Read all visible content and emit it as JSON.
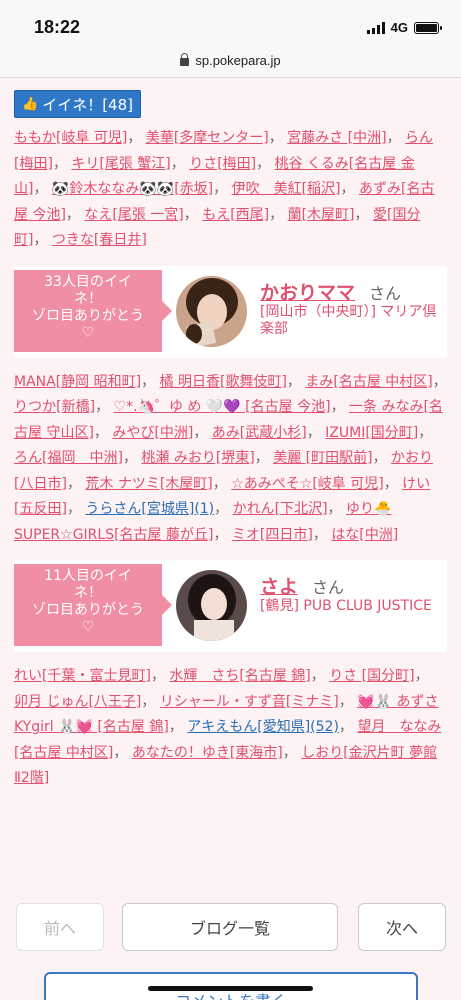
{
  "status": {
    "time": "18:22",
    "network": "4G"
  },
  "browser": {
    "url": "sp.pokepara.jp"
  },
  "like_button": {
    "label": "イイネ！[48]"
  },
  "names_block1": [
    {
      "t": "ももか[岐阜 可児]"
    },
    {
      "t": "美華[多摩センター]"
    },
    {
      "t": "宮藤みさ [中洲]"
    },
    {
      "t": "らん[梅田]"
    },
    {
      "t": "キリ[尾張 蟹江]"
    },
    {
      "t": "りさ[梅田]"
    },
    {
      "t": "桃谷 くるみ[名古屋 金山]"
    },
    {
      "t": "🐼鈴木ななみ🐼🐼[赤坂]"
    },
    {
      "t": "伊吹　美紅[稲沢]"
    },
    {
      "t": "あずみ[名古屋 今池]"
    },
    {
      "t": "なえ[尾張 一宮]"
    },
    {
      "t": "もえ[西尾]"
    },
    {
      "t": "蘭[木屋町]"
    },
    {
      "t": "愛[国分町]"
    },
    {
      "t": "つきな[春日井]"
    }
  ],
  "card1": {
    "badge_line1": "33人目のイイ",
    "badge_line2": "ネ！",
    "badge_line3": "ゾロ目ありがとう",
    "badge_heart": "♡",
    "name": "かおりママ",
    "san": "さん",
    "shop": "[岡山市（中央町）] マリア倶楽部"
  },
  "names_block2": [
    {
      "t": "MANA[静岡 昭和町]"
    },
    {
      "t": "橘 明日香[歌舞伎町]"
    },
    {
      "t": "まみ[名古屋 中村区]"
    },
    {
      "t": "りつか[新橋]"
    },
    {
      "t": "♡*.🦄゜ゆ め 🤍💜 [名古屋 今池]"
    },
    {
      "t": "一条 みなみ[名古屋 守山区]"
    },
    {
      "t": "みやび[中洲]"
    },
    {
      "t": "あみ[武蔵小杉]"
    },
    {
      "t": "IZUMI[国分町]"
    },
    {
      "t": "ろん[福岡　中洲]"
    },
    {
      "t": "桃瀬 みおり[堺東]"
    },
    {
      "t": "美麗 [町田駅前]"
    },
    {
      "t": "かおり[八日市]"
    },
    {
      "t": "荒木 ナツミ[木屋町]"
    },
    {
      "t": "☆あみぺそ☆[岐阜 可児]"
    },
    {
      "t": "けい[五反田]"
    },
    {
      "t": "うらさん[宮城県](1)",
      "blue": true
    },
    {
      "t": "かれん[下北沢]"
    },
    {
      "t": "ゆり🐣SUPER☆GIRLS[名古屋 藤が丘]"
    },
    {
      "t": "ミオ[四日市]"
    },
    {
      "t": "はな[中洲]"
    }
  ],
  "card2": {
    "badge_line1": "11人目のイイ",
    "badge_line2": "ネ！",
    "badge_line3": "ゾロ目ありがとう",
    "badge_heart": "♡",
    "name": "さよ",
    "san": "さん",
    "shop": "[鶴見] PUB CLUB JUSTICE"
  },
  "names_block3": [
    {
      "t": "れい[千葉・富士見町]"
    },
    {
      "t": "水輝　さち[名古屋 錦]"
    },
    {
      "t": "りさ [国分町]"
    },
    {
      "t": "卯月 じゅん[八王子]"
    },
    {
      "t": "リシャール・すず音[ミナミ]"
    },
    {
      "t": "💓🐰 あずさ KYgirl 🐰💓 [名古屋 錦]"
    },
    {
      "t": "アキえもん[愛知県](52)",
      "blue": true
    },
    {
      "t": "望月　ななみ[名古屋 中村区]"
    },
    {
      "t": "あなたの！ゆき[東海市]"
    },
    {
      "t": "しおり[金沢片町 夢館Ⅱ2階]"
    }
  ],
  "pager": {
    "prev": "前へ",
    "list": "ブログ一覧",
    "next": "次へ"
  },
  "comment": {
    "label": "コメントを書く"
  }
}
